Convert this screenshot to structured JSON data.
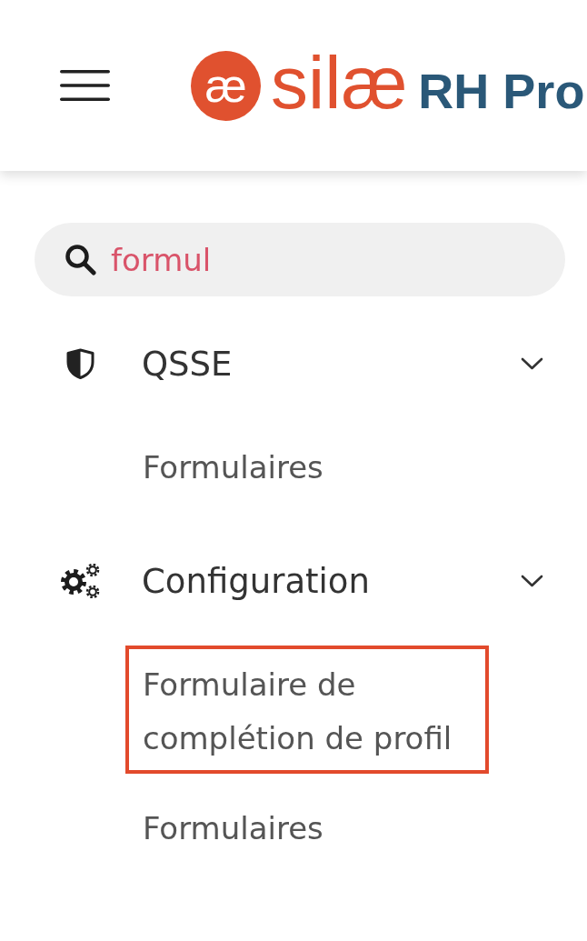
{
  "header": {
    "logo": {
      "mark": "æ",
      "brand": "silæ",
      "product": "RH Pro"
    }
  },
  "search": {
    "value": "formul"
  },
  "nav": [
    {
      "label": "QSSE",
      "expanded": true,
      "items": [
        {
          "label": "Formulaires",
          "highlighted": false
        }
      ]
    },
    {
      "label": "Configuration",
      "expanded": true,
      "items": [
        {
          "label": "Formulaire de complétion de profil",
          "highlighted": true
        },
        {
          "label": "Formulaires",
          "highlighted": false
        }
      ]
    }
  ]
}
